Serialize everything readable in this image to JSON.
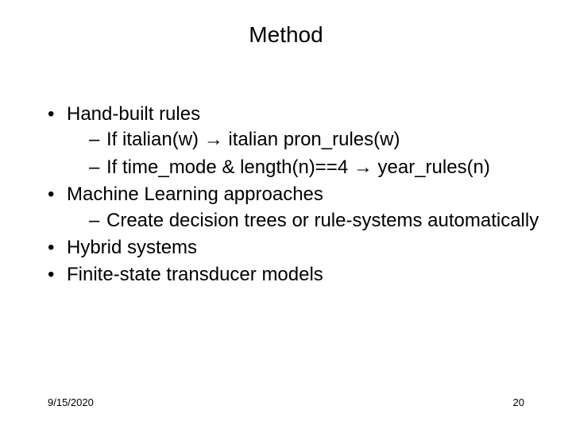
{
  "slide": {
    "title": "Method",
    "bullets": {
      "b1": "Hand-built rules",
      "b1_s1_pre": "If italian(w) ",
      "b1_s1_post": " italian pron_rules(w)",
      "b1_s2_pre": "If time_mode & length(n)==4 ",
      "b1_s2_post": " year_rules(n)",
      "b2": "Machine Learning approaches",
      "b2_s1": "Create decision trees or rule-systems automatically",
      "b3": "Hybrid systems",
      "b4": "Finite-state transducer models"
    },
    "arrow": "→",
    "footer": {
      "date": "9/15/2020",
      "page": "20"
    }
  }
}
